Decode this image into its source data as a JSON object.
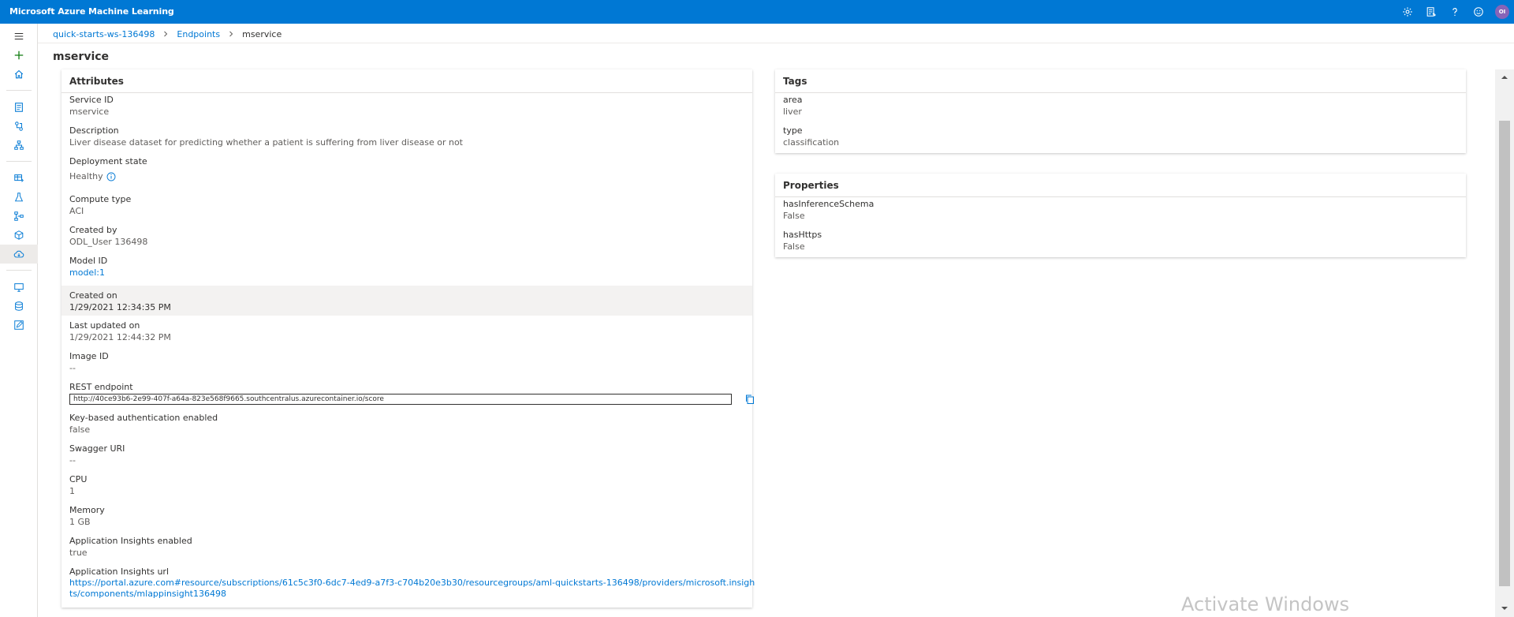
{
  "app": {
    "title": "Microsoft Azure Machine Learning",
    "avatar_initials": "OI"
  },
  "top_icons": [
    "gear-icon",
    "feedback-list-icon",
    "help-icon",
    "smiley-icon"
  ],
  "breadcrumb": {
    "items": [
      "quick-starts-ws-136498",
      "Endpoints"
    ],
    "current": "mservice"
  },
  "page": {
    "title": "mservice"
  },
  "attributes": {
    "header": "Attributes",
    "fields": {
      "service_id": {
        "label": "Service ID",
        "value": "mservice"
      },
      "description": {
        "label": "Description",
        "value": "Liver disease dataset for predicting whether a patient is suffering from liver disease or not"
      },
      "deployment_state": {
        "label": "Deployment state",
        "value": "Healthy"
      },
      "compute_type": {
        "label": "Compute type",
        "value": "ACI"
      },
      "created_by": {
        "label": "Created by",
        "value": "ODL_User 136498"
      },
      "model_id": {
        "label": "Model ID",
        "value": "model:1"
      },
      "created_on": {
        "label": "Created on",
        "value": "1/29/2021 12:34:35 PM"
      },
      "last_updated_on": {
        "label": "Last updated on",
        "value": "1/29/2021 12:44:32 PM"
      },
      "image_id": {
        "label": "Image ID",
        "value": "--"
      },
      "rest_endpoint": {
        "label": "REST endpoint",
        "value": "http://40ce93b6-2e99-407f-a64a-823e568f9665.southcentralus.azurecontainer.io/score"
      },
      "key_auth": {
        "label": "Key-based authentication enabled",
        "value": "false"
      },
      "swagger_uri": {
        "label": "Swagger URI",
        "value": "--"
      },
      "cpu": {
        "label": "CPU",
        "value": "1"
      },
      "memory": {
        "label": "Memory",
        "value": "1 GB"
      },
      "app_insights_enabled": {
        "label": "Application Insights enabled",
        "value": "true"
      },
      "app_insights_url": {
        "label": "Application Insights url",
        "value_line1": "https://portal.azure.com#resource/subscriptions/61c5c3f0-6dc7-4ed9-a7f3-c704b20e3b30/resourcegroups/aml-quickstarts-136498/providers/microsoft.insigh",
        "value_line2": "ts/components/mlappinsight136498"
      }
    }
  },
  "tags": {
    "header": "Tags",
    "items": [
      {
        "label": "area",
        "value": "liver"
      },
      {
        "label": "type",
        "value": "classification"
      }
    ]
  },
  "properties": {
    "header": "Properties",
    "items": [
      {
        "label": "hasInferenceSchema",
        "value": "False"
      },
      {
        "label": "hasHttps",
        "value": "False"
      }
    ]
  },
  "watermark": "Activate Windows",
  "colors": {
    "brand": "#0078d4",
    "link": "#0078d4",
    "highlight": "#f3f2f1",
    "avatar": "#8764b8"
  }
}
